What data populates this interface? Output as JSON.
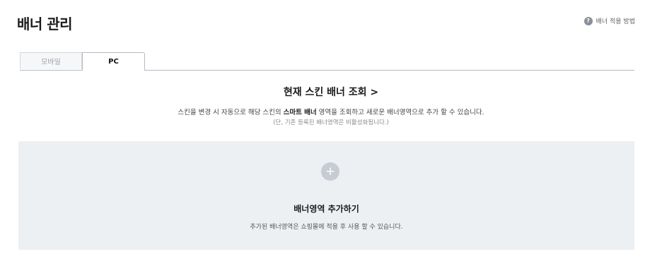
{
  "header": {
    "title": "배너 관리",
    "help_label": "배너 적용 방법",
    "help_icon": "?"
  },
  "tabs": [
    {
      "label": "모바일",
      "active": false
    },
    {
      "label": "PC",
      "active": true
    }
  ],
  "current_skin": {
    "title": "현재 스킨 배너 조회",
    "chevron": ">",
    "desc_before": "스킨을 변경 시 자동으로 해당 스킨의 ",
    "desc_bold": "스마트 배너",
    "desc_after": " 영역을 조회하고 새로운 배너영역으로 추가 할 수 있습니다.",
    "note": "(단, 기존 등록된 배너영역은 비활성화됩니다.)"
  },
  "add_area": {
    "plus": "+",
    "title": "배너영역 추가하기",
    "desc": "추가된 배너영역은 쇼핑몰에 적용 후 사용 할 수 있습니다."
  },
  "colors": {
    "panel_bg": "#edf0f3",
    "plus_circle": "#c7ccd3",
    "help_icon_bg": "#8a8f98"
  }
}
